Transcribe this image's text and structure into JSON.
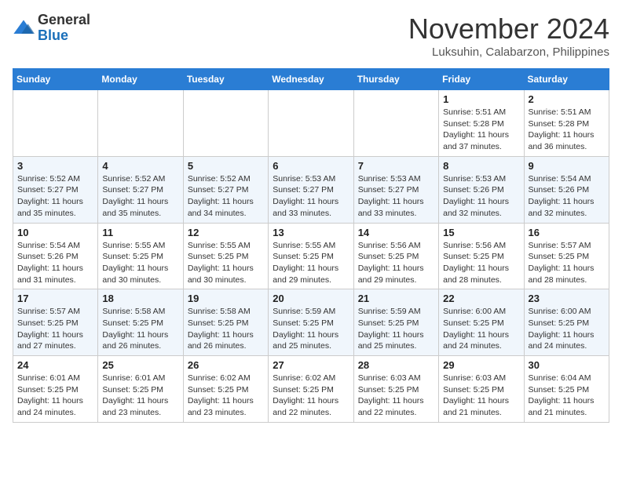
{
  "logo": {
    "general": "General",
    "blue": "Blue"
  },
  "header": {
    "month": "November 2024",
    "location": "Luksuhin, Calabarzon, Philippines"
  },
  "weekdays": [
    "Sunday",
    "Monday",
    "Tuesday",
    "Wednesday",
    "Thursday",
    "Friday",
    "Saturday"
  ],
  "weeks": [
    [
      {
        "day": "",
        "info": ""
      },
      {
        "day": "",
        "info": ""
      },
      {
        "day": "",
        "info": ""
      },
      {
        "day": "",
        "info": ""
      },
      {
        "day": "",
        "info": ""
      },
      {
        "day": "1",
        "info": "Sunrise: 5:51 AM\nSunset: 5:28 PM\nDaylight: 11 hours and 37 minutes."
      },
      {
        "day": "2",
        "info": "Sunrise: 5:51 AM\nSunset: 5:28 PM\nDaylight: 11 hours and 36 minutes."
      }
    ],
    [
      {
        "day": "3",
        "info": "Sunrise: 5:52 AM\nSunset: 5:27 PM\nDaylight: 11 hours and 35 minutes."
      },
      {
        "day": "4",
        "info": "Sunrise: 5:52 AM\nSunset: 5:27 PM\nDaylight: 11 hours and 35 minutes."
      },
      {
        "day": "5",
        "info": "Sunrise: 5:52 AM\nSunset: 5:27 PM\nDaylight: 11 hours and 34 minutes."
      },
      {
        "day": "6",
        "info": "Sunrise: 5:53 AM\nSunset: 5:27 PM\nDaylight: 11 hours and 33 minutes."
      },
      {
        "day": "7",
        "info": "Sunrise: 5:53 AM\nSunset: 5:27 PM\nDaylight: 11 hours and 33 minutes."
      },
      {
        "day": "8",
        "info": "Sunrise: 5:53 AM\nSunset: 5:26 PM\nDaylight: 11 hours and 32 minutes."
      },
      {
        "day": "9",
        "info": "Sunrise: 5:54 AM\nSunset: 5:26 PM\nDaylight: 11 hours and 32 minutes."
      }
    ],
    [
      {
        "day": "10",
        "info": "Sunrise: 5:54 AM\nSunset: 5:26 PM\nDaylight: 11 hours and 31 minutes."
      },
      {
        "day": "11",
        "info": "Sunrise: 5:55 AM\nSunset: 5:25 PM\nDaylight: 11 hours and 30 minutes."
      },
      {
        "day": "12",
        "info": "Sunrise: 5:55 AM\nSunset: 5:25 PM\nDaylight: 11 hours and 30 minutes."
      },
      {
        "day": "13",
        "info": "Sunrise: 5:55 AM\nSunset: 5:25 PM\nDaylight: 11 hours and 29 minutes."
      },
      {
        "day": "14",
        "info": "Sunrise: 5:56 AM\nSunset: 5:25 PM\nDaylight: 11 hours and 29 minutes."
      },
      {
        "day": "15",
        "info": "Sunrise: 5:56 AM\nSunset: 5:25 PM\nDaylight: 11 hours and 28 minutes."
      },
      {
        "day": "16",
        "info": "Sunrise: 5:57 AM\nSunset: 5:25 PM\nDaylight: 11 hours and 28 minutes."
      }
    ],
    [
      {
        "day": "17",
        "info": "Sunrise: 5:57 AM\nSunset: 5:25 PM\nDaylight: 11 hours and 27 minutes."
      },
      {
        "day": "18",
        "info": "Sunrise: 5:58 AM\nSunset: 5:25 PM\nDaylight: 11 hours and 26 minutes."
      },
      {
        "day": "19",
        "info": "Sunrise: 5:58 AM\nSunset: 5:25 PM\nDaylight: 11 hours and 26 minutes."
      },
      {
        "day": "20",
        "info": "Sunrise: 5:59 AM\nSunset: 5:25 PM\nDaylight: 11 hours and 25 minutes."
      },
      {
        "day": "21",
        "info": "Sunrise: 5:59 AM\nSunset: 5:25 PM\nDaylight: 11 hours and 25 minutes."
      },
      {
        "day": "22",
        "info": "Sunrise: 6:00 AM\nSunset: 5:25 PM\nDaylight: 11 hours and 24 minutes."
      },
      {
        "day": "23",
        "info": "Sunrise: 6:00 AM\nSunset: 5:25 PM\nDaylight: 11 hours and 24 minutes."
      }
    ],
    [
      {
        "day": "24",
        "info": "Sunrise: 6:01 AM\nSunset: 5:25 PM\nDaylight: 11 hours and 24 minutes."
      },
      {
        "day": "25",
        "info": "Sunrise: 6:01 AM\nSunset: 5:25 PM\nDaylight: 11 hours and 23 minutes."
      },
      {
        "day": "26",
        "info": "Sunrise: 6:02 AM\nSunset: 5:25 PM\nDaylight: 11 hours and 23 minutes."
      },
      {
        "day": "27",
        "info": "Sunrise: 6:02 AM\nSunset: 5:25 PM\nDaylight: 11 hours and 22 minutes."
      },
      {
        "day": "28",
        "info": "Sunrise: 6:03 AM\nSunset: 5:25 PM\nDaylight: 11 hours and 22 minutes."
      },
      {
        "day": "29",
        "info": "Sunrise: 6:03 AM\nSunset: 5:25 PM\nDaylight: 11 hours and 21 minutes."
      },
      {
        "day": "30",
        "info": "Sunrise: 6:04 AM\nSunset: 5:25 PM\nDaylight: 11 hours and 21 minutes."
      }
    ]
  ]
}
